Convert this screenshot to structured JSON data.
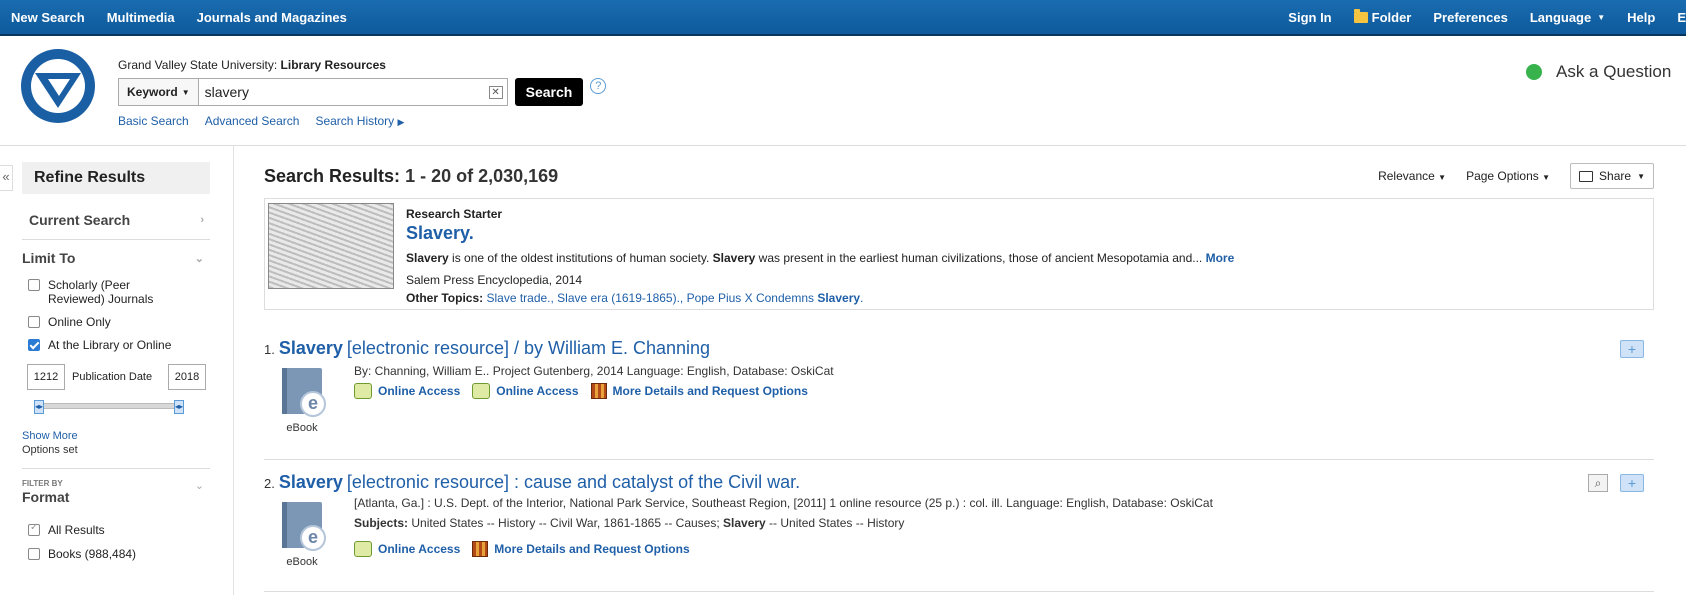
{
  "topbar": {
    "left": [
      "New Search",
      "Multimedia",
      "Journals and Magazines"
    ],
    "sign_in": "Sign In",
    "folder": "Folder",
    "preferences": "Preferences",
    "language": "Language",
    "help": "Help",
    "cut": "E"
  },
  "header": {
    "institution": "Grand Valley State University:",
    "institution_bold": "Library Resources",
    "search_field": "Keyword",
    "query": "slavery",
    "search_button": "Search",
    "help": "?",
    "links": [
      "Basic Search",
      "Advanced Search",
      "Search History"
    ],
    "ask": "Ask a Question"
  },
  "sidebar": {
    "collapse": "«",
    "refine": "Refine Results",
    "current_search": "Current Search",
    "limit_to": "Limit To",
    "limits": [
      {
        "label": "Scholarly (Peer Reviewed) Journals",
        "checked": false
      },
      {
        "label": "Online Only",
        "checked": false
      },
      {
        "label": "At the Library or Online",
        "checked": true
      }
    ],
    "date_from": "1212",
    "date_label": "Publication Date",
    "date_to": "2018",
    "show_more": "Show More",
    "options_set": "Options set",
    "filter_by": "FILTER BY",
    "format": "Format",
    "formats": [
      {
        "label": "All Results",
        "checked": true
      },
      {
        "label": "Books (988,484)",
        "checked": false
      }
    ]
  },
  "results": {
    "label": "Search Results:",
    "range": "1 - 20 of 2,030,169",
    "sort": "Relevance",
    "page_options": "Page Options",
    "share": "Share",
    "starter": {
      "label": "Research Starter",
      "title": "Slavery.",
      "snippet_b1": "Slavery",
      "snippet_1": " is one of the oldest institutions of human society. ",
      "snippet_b2": "Slavery",
      "snippet_2": " was present in the earliest human civilizations, those of ancient Mesopotamia and... ",
      "more": "More",
      "source": "Salem Press Encyclopedia, 2014",
      "other_topics_label": "Other Topics:",
      "topics": "Slave trade., Slave era (1619-1865)., Pope Pius X Condemns ",
      "topics_bold": "Slavery",
      "topics_end": "."
    },
    "items": [
      {
        "num": "1.",
        "title_bold": "Slavery",
        "title_rest": "[electronic resource] / by William E. Channing",
        "meta": "By: Channing, William E.. Project Gutenberg, 2014 Language: English, Database: OskiCat",
        "format": "eBook",
        "links": [
          "Online Access",
          "Online Access",
          "More Details and Request Options"
        ]
      },
      {
        "num": "2.",
        "title_bold": "Slavery",
        "title_rest": "[electronic resource] : cause and catalyst of the Civil war.",
        "meta": "[Atlanta, Ga.] : U.S. Dept. of the Interior, National Park Service, Southeast Region, [2011] 1 online resource (25 p.) : col. ill. Language: English, Database: OskiCat",
        "subjects_label": "Subjects:",
        "subjects_1": " United States -- History -- Civil War, 1861-1865 -- Causes; ",
        "subjects_bold": "Slavery",
        "subjects_2": " -- United States -- History",
        "format": "eBook",
        "links": [
          "Online Access",
          "More Details and Request Options"
        ]
      }
    ]
  },
  "colors": {
    "topbar": "#1a6cb0",
    "link": "#1f5fa8",
    "logo": "#1a5fa3"
  }
}
